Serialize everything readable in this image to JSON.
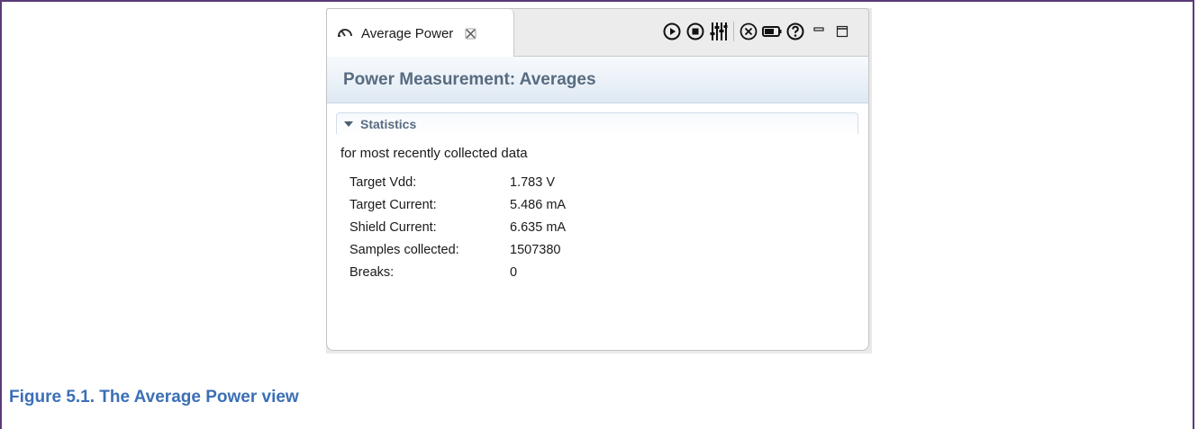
{
  "view": {
    "tab_label": "Average Power",
    "tab_icon": "power-gauge-icon",
    "tab_close_icon": "close-x-icon",
    "toolbar": {
      "buttons": [
        {
          "name": "start-button",
          "icon": "play-circle-icon"
        },
        {
          "name": "stop-button",
          "icon": "stop-circle-icon"
        },
        {
          "name": "settings-button",
          "icon": "sliders-icon"
        },
        {
          "name": "clear-button",
          "icon": "clear-circle-icon"
        },
        {
          "name": "battery-button",
          "icon": "battery-icon"
        },
        {
          "name": "help-button",
          "icon": "help-circle-icon"
        },
        {
          "name": "minimize-button",
          "icon": "minimize-icon"
        },
        {
          "name": "maximize-button",
          "icon": "maximize-icon"
        }
      ]
    },
    "header_title": "Power Measurement: Averages",
    "section": {
      "title": "Statistics",
      "description": "for most recently collected data",
      "stats": [
        {
          "label": "Target Vdd:",
          "value": "1.783 V"
        },
        {
          "label": "Target Current:",
          "value": "5.486 mA"
        },
        {
          "label": "Shield Current:",
          "value": "6.635 mA"
        },
        {
          "label": "Samples collected:",
          "value": "1507380"
        },
        {
          "label": "Breaks:",
          "value": "0"
        }
      ]
    }
  },
  "caption": "Figure 5.1. The Average Power view",
  "colors": {
    "frame": "#5a3a78",
    "caption": "#3b6fb6",
    "header_text": "#586b80"
  }
}
